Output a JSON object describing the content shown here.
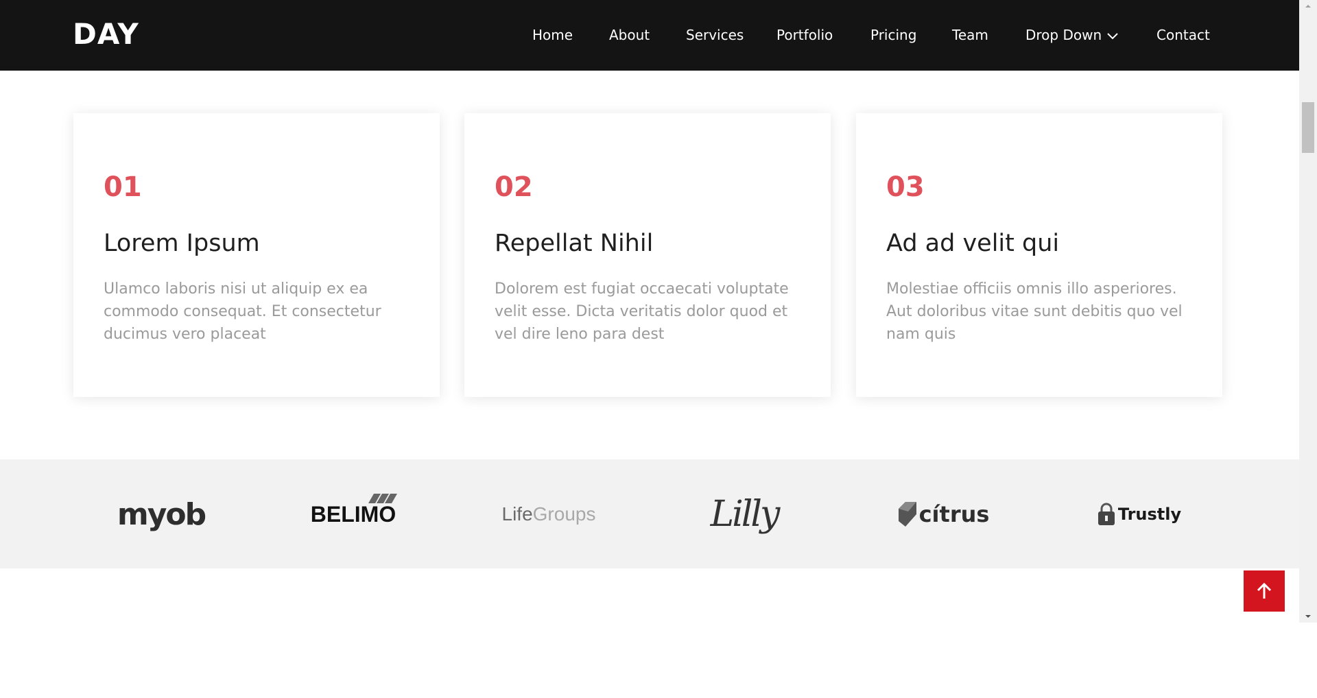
{
  "header": {
    "brand": "DAY",
    "nav": [
      {
        "label": "Home"
      },
      {
        "label": "About"
      },
      {
        "label": "Services"
      },
      {
        "label": "Portfolio"
      },
      {
        "label": "Pricing"
      },
      {
        "label": "Team"
      },
      {
        "label": "Drop Down",
        "icon": "chevron-down-icon"
      },
      {
        "label": "Contact"
      }
    ]
  },
  "features": [
    {
      "number": "01",
      "title": "Lorem Ipsum",
      "text": "Ulamco laboris nisi ut aliquip ex ea commodo consequat. Et consectetur ducimus vero placeat"
    },
    {
      "number": "02",
      "title": "Repellat Nihil",
      "text": "Dolorem est fugiat occaecati voluptate velit esse. Dicta veritatis dolor quod et vel dire leno para dest"
    },
    {
      "number": "03",
      "title": "Ad ad velit qui",
      "text": "Molestiae officiis omnis illo asperiores. Aut doloribus vitae sunt debitis quo vel nam quis"
    }
  ],
  "clients": [
    {
      "name": "myob"
    },
    {
      "name": "BELIMO"
    },
    {
      "name": "LifeGroups",
      "part1": "Life",
      "part2": "Groups"
    },
    {
      "name": "Lilly"
    },
    {
      "name": "citrus",
      "display": "cítrus"
    },
    {
      "name": "Trustly"
    }
  ],
  "back_to_top": {
    "icon": "arrow-up-icon"
  },
  "colors": {
    "header_bg": "#141414",
    "accent_number": "#e0525b",
    "back_to_top": "#d2151e",
    "logos_bg": "#f2f2f2"
  }
}
